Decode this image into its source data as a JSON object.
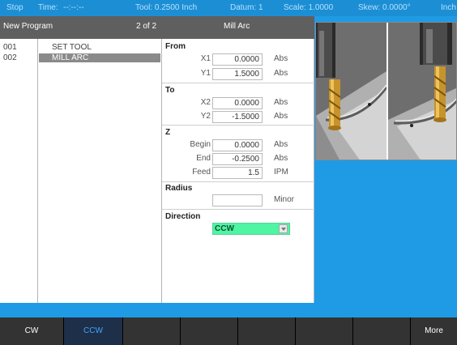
{
  "status": {
    "stop": "Stop",
    "time_label": "Time:",
    "time_value": "--:--:--",
    "tool": "Tool: 0.2500 Inch",
    "datum": "Datum: 1",
    "scale": "Scale: 1.0000",
    "skew": "Skew: 0.0000°",
    "units": "Inch"
  },
  "titlebar": {
    "program": "New Program",
    "step_count": "2 of 2",
    "cycle": "Mill Arc"
  },
  "steps": [
    {
      "num": "001",
      "name": "SET TOOL"
    },
    {
      "num": "002",
      "name": "MILL ARC"
    }
  ],
  "form": {
    "from": {
      "title": "From",
      "x1_label": "X1",
      "x1_value": "0.0000",
      "x1_unit": "Abs",
      "y1_label": "Y1",
      "y1_value": "1.5000",
      "y1_unit": "Abs"
    },
    "to": {
      "title": "To",
      "x2_label": "X2",
      "x2_value": "0.0000",
      "x2_unit": "Abs",
      "y2_label": "Y2",
      "y2_value": "-1.5000",
      "y2_unit": "Abs"
    },
    "z": {
      "title": "Z",
      "begin_label": "Begin",
      "begin_value": "0.0000",
      "begin_unit": "Abs",
      "end_label": "End",
      "end_value": "-0.2500",
      "end_unit": "Abs",
      "feed_label": "Feed",
      "feed_value": "1.5",
      "feed_unit": "IPM"
    },
    "radius": {
      "title": "Radius",
      "value": "",
      "unit": "Minor"
    },
    "direction": {
      "title": "Direction",
      "selected": "CCW"
    }
  },
  "softkeys": [
    "CW",
    "CCW",
    "",
    "",
    "",
    "",
    "",
    "More"
  ],
  "colors": {
    "background": "#1f9be6",
    "status_bar": "#1c8fd4",
    "title_bar": "#5f5f5f",
    "selected_row": "#8a8a8a",
    "dropdown": "#4ef5a2",
    "softkey_bar": "#333333",
    "softkey_active_text": "#3fa6ff"
  },
  "preview_image": "mill-arc-tool-illustration"
}
